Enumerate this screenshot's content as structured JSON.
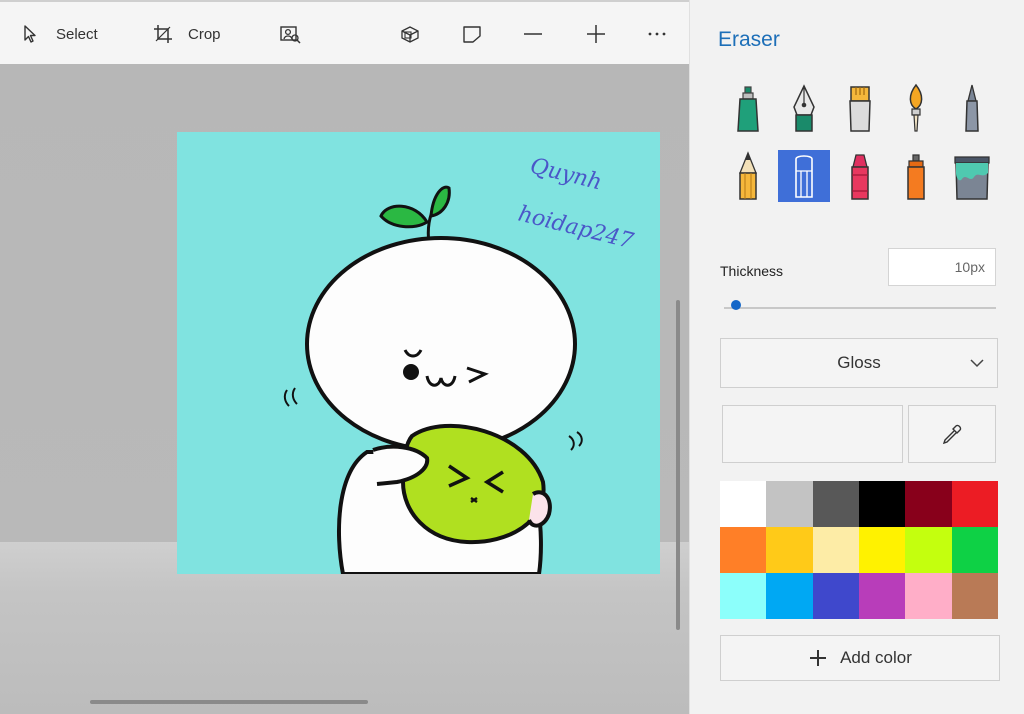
{
  "toolbar": {
    "select_label": "Select",
    "crop_label": "Crop",
    "icons": [
      "cursor-icon",
      "crop-icon",
      "magic-select-icon",
      "view-3d-icon",
      "sticker-icon",
      "minus-icon",
      "plus-icon",
      "more-icon"
    ]
  },
  "canvas": {
    "background": "#80e3e0",
    "watermark_line1": "Quynh",
    "watermark_line2": "hoidap247"
  },
  "panel": {
    "title": "Eraser",
    "brushes": [
      {
        "name": "marker",
        "selected": false
      },
      {
        "name": "calligraphy-pen",
        "selected": false
      },
      {
        "name": "oil-brush",
        "selected": false
      },
      {
        "name": "watercolor",
        "selected": false
      },
      {
        "name": "pixel-pen",
        "selected": false
      },
      {
        "name": "pencil",
        "selected": false
      },
      {
        "name": "eraser",
        "selected": true
      },
      {
        "name": "crayon",
        "selected": false
      },
      {
        "name": "spray-can",
        "selected": false
      },
      {
        "name": "fill",
        "selected": false
      }
    ],
    "thickness_label": "Thickness",
    "thickness_value": "10px",
    "thickness_fraction": 0.03,
    "finish_value": "Gloss",
    "add_color_label": "Add color",
    "palette": [
      "#ffffff",
      "#c3c3c3",
      "#585858",
      "#000000",
      "#88001b",
      "#ec1c24",
      "#ff7f27",
      "#ffca18",
      "#fdeca6",
      "#fff200",
      "#c4ff0e",
      "#0ed145",
      "#8cfffb",
      "#00a8f3",
      "#3f48cc",
      "#b83dba",
      "#ffaec8",
      "#b97a56"
    ]
  }
}
